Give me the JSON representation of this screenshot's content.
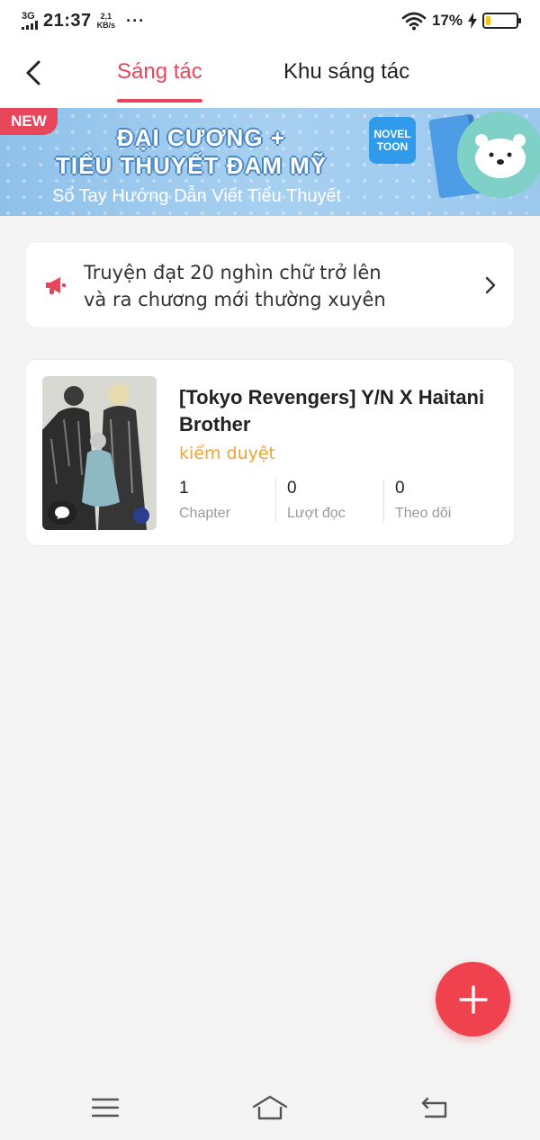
{
  "status_bar": {
    "network": "3G",
    "time": "21:37",
    "speed_value": "2,1",
    "speed_unit": "KB/s",
    "more": "···",
    "battery_percent": "17%",
    "battery_level": 0.17,
    "battery_color": "#f5c518"
  },
  "header": {
    "tabs": [
      {
        "label": "Sáng tác",
        "active": true
      },
      {
        "label": "Khu sáng tác",
        "active": false
      }
    ],
    "accent_color": "#e8475b"
  },
  "banner": {
    "badge": "NEW",
    "line1": "ĐẠI CƯƠNG +",
    "line2": "TIỂU THUYẾT ĐAM MỸ",
    "line3": "Sổ Tay Hướng Dẫn Viết Tiểu Thuyết",
    "logo_line1": "NOVEL",
    "logo_line2": "TOON"
  },
  "notice": {
    "icon": "megaphone-icon",
    "text_line1": "Truyện đạt 20 nghìn chữ trở lên",
    "text_line2": "và ra chương mới thường xuyên"
  },
  "story": {
    "title": "[Tokyo Revengers] Y/N X Haitani Brother",
    "status": "kiểm duyệt",
    "status_color": "#f0a43a",
    "stats": [
      {
        "value": "1",
        "label": "Chapter"
      },
      {
        "value": "0",
        "label": "Lượt đọc"
      },
      {
        "value": "0",
        "label": "Theo dõi"
      }
    ]
  },
  "fab": {
    "icon": "plus-icon",
    "color": "#f0414e"
  },
  "navbar": {
    "icons": [
      "menu-icon",
      "home-icon",
      "back-icon"
    ]
  }
}
